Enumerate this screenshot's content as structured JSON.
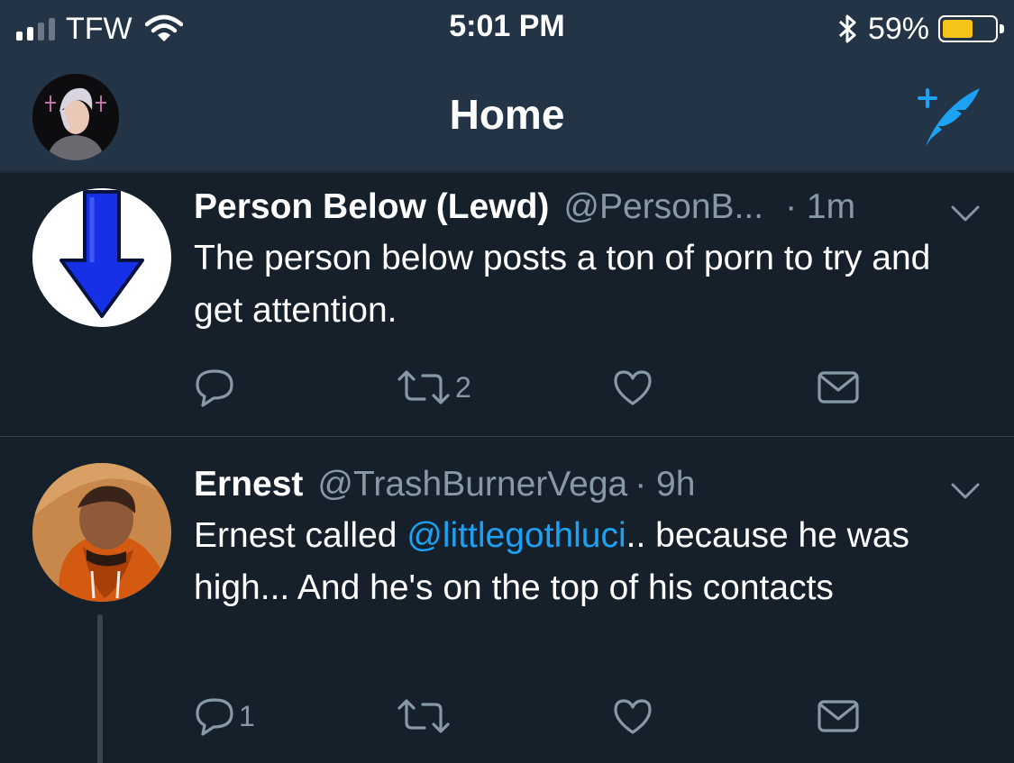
{
  "status_bar": {
    "carrier": "TFW",
    "time": "5:01 PM",
    "battery_percent": "59%",
    "battery_level": 0.59,
    "signal_bars": 2,
    "icons": [
      "signal-icon",
      "wifi-icon",
      "bluetooth-icon",
      "battery-icon"
    ]
  },
  "nav": {
    "title": "Home",
    "compose_icon": "compose-tweet-icon"
  },
  "colors": {
    "background": "#15202b",
    "bar": "#243447",
    "accent": "#1da1f2",
    "secondary_text": "#8899a6",
    "battery": "#f5c31a"
  },
  "tweets": [
    {
      "name": "Person Below (Lewd)",
      "handle": "@PersonB...",
      "time": "· 1m",
      "text": "The person below posts a ton of porn to try and get attention.",
      "reply_count": "",
      "retweet_count": "2",
      "like_count": ""
    },
    {
      "name": "Ernest",
      "handle": "@TrashBurnerVega",
      "time": "· 9h",
      "text_before": "Ernest called ",
      "mention": "@littlegothluci",
      "text_after": ".. because he was high... And he's on the top of his contacts",
      "reply_count": "1",
      "retweet_count": "",
      "like_count": ""
    }
  ]
}
